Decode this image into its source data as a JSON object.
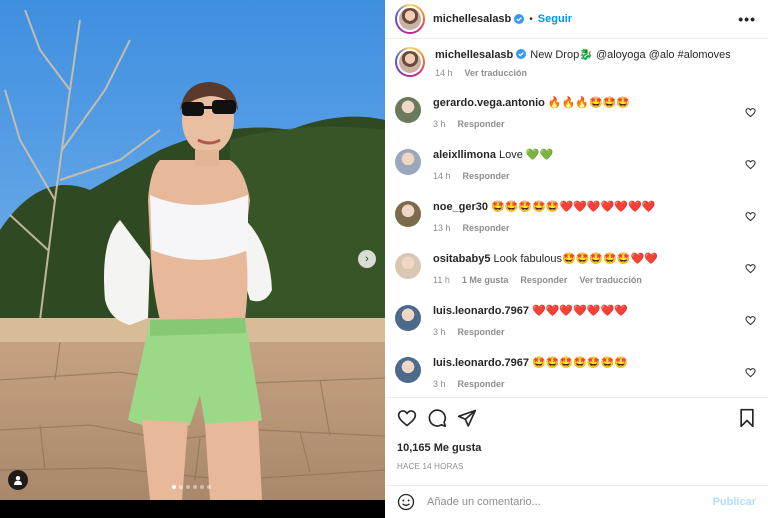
{
  "post": {
    "author": "michellesalasb",
    "follow_label": "Seguir",
    "more_label": "•••",
    "separator": "•"
  },
  "caption": {
    "user": "michellesalasb",
    "text": "New Drop🐉 @aloyoga @alo #alomoves",
    "time": "14 h",
    "translate": "Ver traducción"
  },
  "comments": [
    {
      "user": "gerardo.vega.antonio",
      "text": "🔥🔥🔥🤩🤩🤩",
      "time": "3 h",
      "likes": "",
      "reply": "Responder",
      "translate": "",
      "avatar_color": "#6a7a5a"
    },
    {
      "user": "aleixllimona",
      "text": "Love 💚💚",
      "time": "14 h",
      "likes": "",
      "reply": "Responder",
      "translate": "",
      "avatar_color": "#9aa7bd"
    },
    {
      "user": "noe_ger30",
      "text": "🤩🤩🤩🤩🤩❤️❤️❤️❤️❤️❤️❤️",
      "time": "13 h",
      "likes": "",
      "reply": "Responder",
      "translate": "",
      "avatar_color": "#7b6a4c"
    },
    {
      "user": "ositababy5",
      "text": "Look fabulous🤩🤩🤩🤩🤩❤️❤️",
      "time": "11 h",
      "likes": "1 Me gusta",
      "reply": "Responder",
      "translate": "Ver traducción",
      "avatar_color": "#d7c7b3"
    },
    {
      "user": "luis.leonardo.7967",
      "text": "❤️❤️❤️❤️❤️❤️❤️",
      "time": "3 h",
      "likes": "",
      "reply": "Responder",
      "translate": "",
      "avatar_color": "#4c6a8a"
    },
    {
      "user": "luis.leonardo.7967",
      "text": "🤩🤩🤩🤩🤩🤩🤩",
      "time": "3 h",
      "likes": "",
      "reply": "Responder",
      "translate": "",
      "avatar_color": "#4c6a8a"
    }
  ],
  "stats": {
    "likes": "10,165 Me gusta",
    "ago": "HACE 14 HORAS"
  },
  "composer": {
    "placeholder": "Añade un comentario...",
    "post_label": "Publicar"
  },
  "colors": {
    "accent": "#0095f6",
    "verified": "#3897f0",
    "post_disabled": "#b2dffc"
  },
  "carousel": {
    "total": 6,
    "current": 1
  }
}
